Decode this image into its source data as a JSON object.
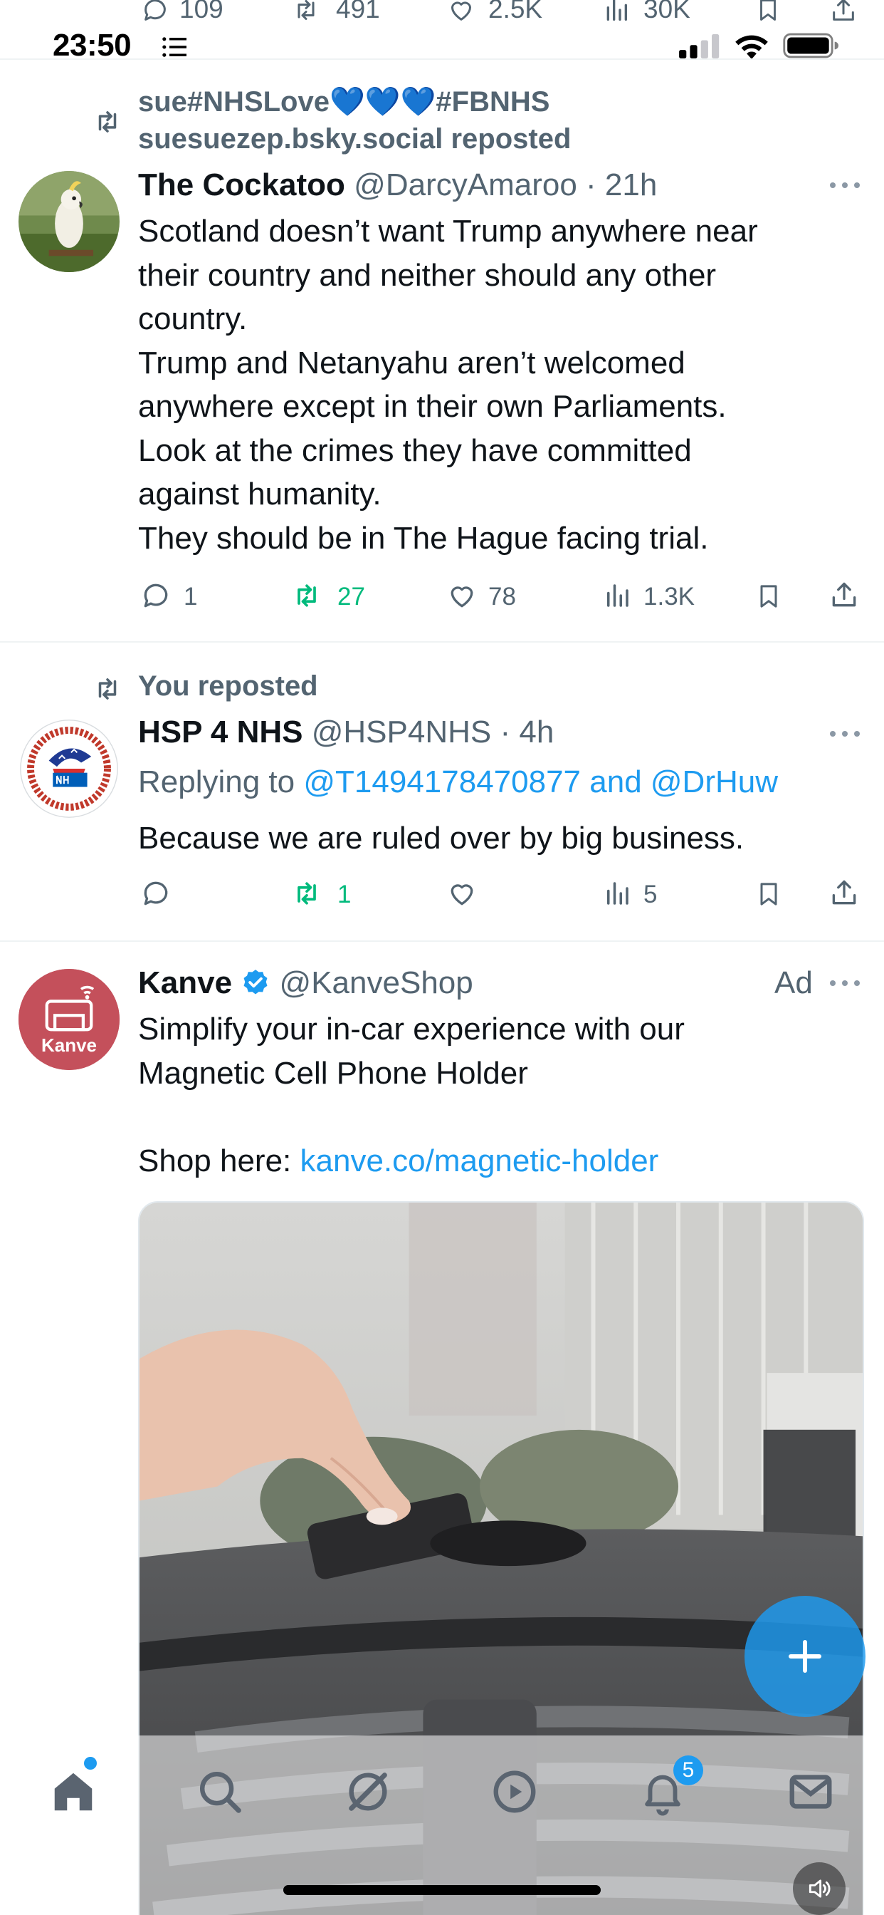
{
  "previous_tweet": {
    "replies": "109",
    "reposts": "491",
    "likes": "2.5K",
    "views": "30K"
  },
  "status_bar": {
    "time": "23:50"
  },
  "tweets": [
    {
      "context_line1": "sue#NHSLove💙💙💙#FBNHS",
      "context_line2": "suesuezep.bsky.social reposted",
      "name": "The Cockatoo",
      "handle": "@DarcyAmaroo",
      "time": "· 21h",
      "lines": [
        "Scotland doesn’t want Trump anywhere near",
        "their country and neither should any other",
        "country.",
        "Trump and Netanyahu aren’t welcomed",
        "anywhere except in their own Parliaments.",
        "Look at the crimes they have committed",
        "against humanity.",
        "They should be in The Hague facing trial."
      ],
      "replies": "1",
      "reposts": "27",
      "likes": "78",
      "views": "1.3K"
    },
    {
      "context": "You reposted",
      "name": "HSP 4 NHS",
      "handle": "@HSP4NHS",
      "time": "· 4h",
      "replying_prefix": "Replying to ",
      "replying_targets": "@T1494178470877 and @DrHuw",
      "text": "Because we are ruled over by big business.",
      "replies": "",
      "reposts": "1",
      "likes": "",
      "views": "5"
    },
    {
      "name": "Kanve",
      "handle": "@KanveShop",
      "ad_label": "Ad",
      "avatar_text": "Kanve",
      "line1": "Simplify your in-car experience with our",
      "line2": "Magnetic Cell Phone Holder",
      "shop_prefix": "Shop here: ",
      "shop_link": "kanve.co/magnetic-holder"
    }
  ],
  "tab_bar": {
    "tabs": [
      "home-icon",
      "search-icon",
      "grok-icon",
      "video-icon",
      "notifications-icon",
      "messages-icon"
    ],
    "notification_count": "5"
  },
  "colors": {
    "accent": "#1d9bf0",
    "repost_green": "#00ba7c",
    "secondary_text": "#536471",
    "kanve_brand": "#c4505b"
  }
}
